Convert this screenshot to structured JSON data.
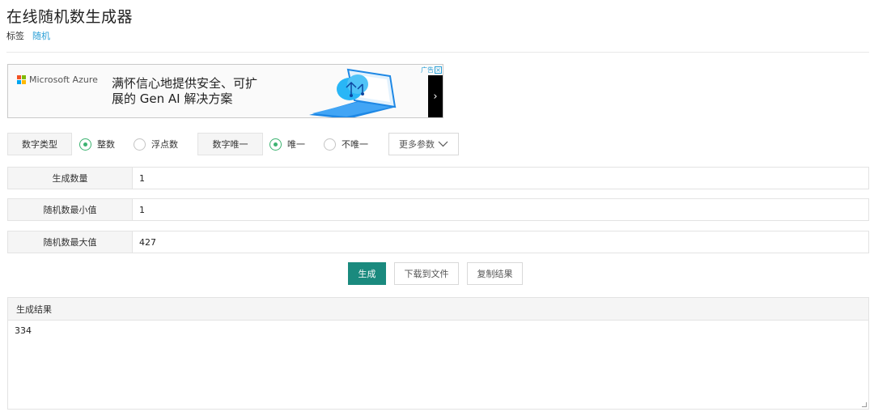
{
  "page": {
    "title": "在线随机数生成器",
    "tags_label": "标签",
    "tag_link": "随机"
  },
  "ad": {
    "brand": "Microsoft Azure",
    "headline_line1": "满怀信心地提供安全、可扩",
    "headline_line2": "展的 Gen AI 解决方案",
    "badge": "广告",
    "close": "×",
    "arrow": "›"
  },
  "options": {
    "number_type_label": "数字类型",
    "integer_label": "整数",
    "float_label": "浮点数",
    "unique_label": "数字唯一",
    "unique_yes_label": "唯一",
    "unique_no_label": "不唯一",
    "more_label": "更多参数",
    "selected_type": "整数",
    "selected_unique": "唯一",
    "accent_color": "#3cb371"
  },
  "fields": {
    "count": {
      "label": "生成数量",
      "value": "1"
    },
    "min": {
      "label": "随机数最小值",
      "value": "1"
    },
    "max": {
      "label": "随机数最大值",
      "value": "427"
    }
  },
  "actions": {
    "generate_label": "生成",
    "download_label": "下载到文件",
    "copy_label": "复制结果",
    "primary_color": "#1a8a7e"
  },
  "result": {
    "header": "生成结果",
    "value": "334"
  }
}
